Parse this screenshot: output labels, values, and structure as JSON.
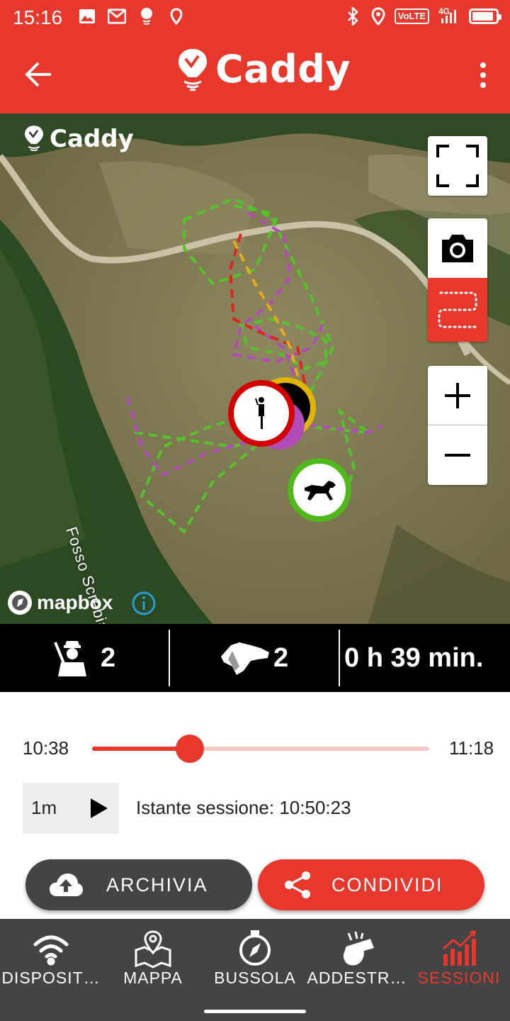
{
  "status_bar": {
    "time": "15:16",
    "volte": "VoLTE",
    "network": "4G",
    "battery_level": 0.9,
    "notification_icons": [
      "image-icon",
      "gmail-icon",
      "caddy-notify-icon",
      "location-pin-icon"
    ],
    "system_icons": [
      "bluetooth-icon",
      "location-icon",
      "volte-icon",
      "signal-icon",
      "battery-icon"
    ]
  },
  "header": {
    "brand": "Caddy",
    "back_icon": "arrow-left-icon",
    "menu_icon": "more-vert-icon",
    "brand_color": "#e8372c"
  },
  "map": {
    "brand": "Caddy",
    "attribution": "mapbox",
    "place_label": "Fosso Screbia",
    "controls": [
      "fullscreen-icon",
      "camera-icon",
      "route-icon",
      "plus-icon",
      "minus-icon"
    ],
    "markers": [
      {
        "type": "handler",
        "ring_color": "#d40000",
        "icon": "person-icon"
      },
      {
        "type": "dog",
        "ring_color": "#4fb81a",
        "icon": "dog-icon"
      },
      {
        "type": "track",
        "ring_color": "#e2b400"
      }
    ],
    "track_colors": [
      "#56c22b",
      "#b04bb8",
      "#e0261c",
      "#e5a91c"
    ]
  },
  "stats": {
    "handlers_count": "2",
    "dogs_count": "2",
    "duration": "0 h 39 min."
  },
  "timeline": {
    "start": "10:38",
    "end": "11:18",
    "progress": 0.29,
    "step": "1m",
    "session_label": "Istante sessione: 10:50:23"
  },
  "actions": {
    "archive_label": "ARCHIVIA",
    "share_label": "CONDIVIDI"
  },
  "bottom_nav": {
    "items": [
      {
        "label": "DISPOSIT…",
        "icon": "wifi-icon",
        "active": false
      },
      {
        "label": "MAPPA",
        "icon": "map-icon",
        "active": false
      },
      {
        "label": "BUSSOLA",
        "icon": "compass-icon",
        "active": false
      },
      {
        "label": "ADDESTR…",
        "icon": "whistle-icon",
        "active": false
      },
      {
        "label": "SESSIONI",
        "icon": "chart-icon",
        "active": true
      }
    ]
  }
}
